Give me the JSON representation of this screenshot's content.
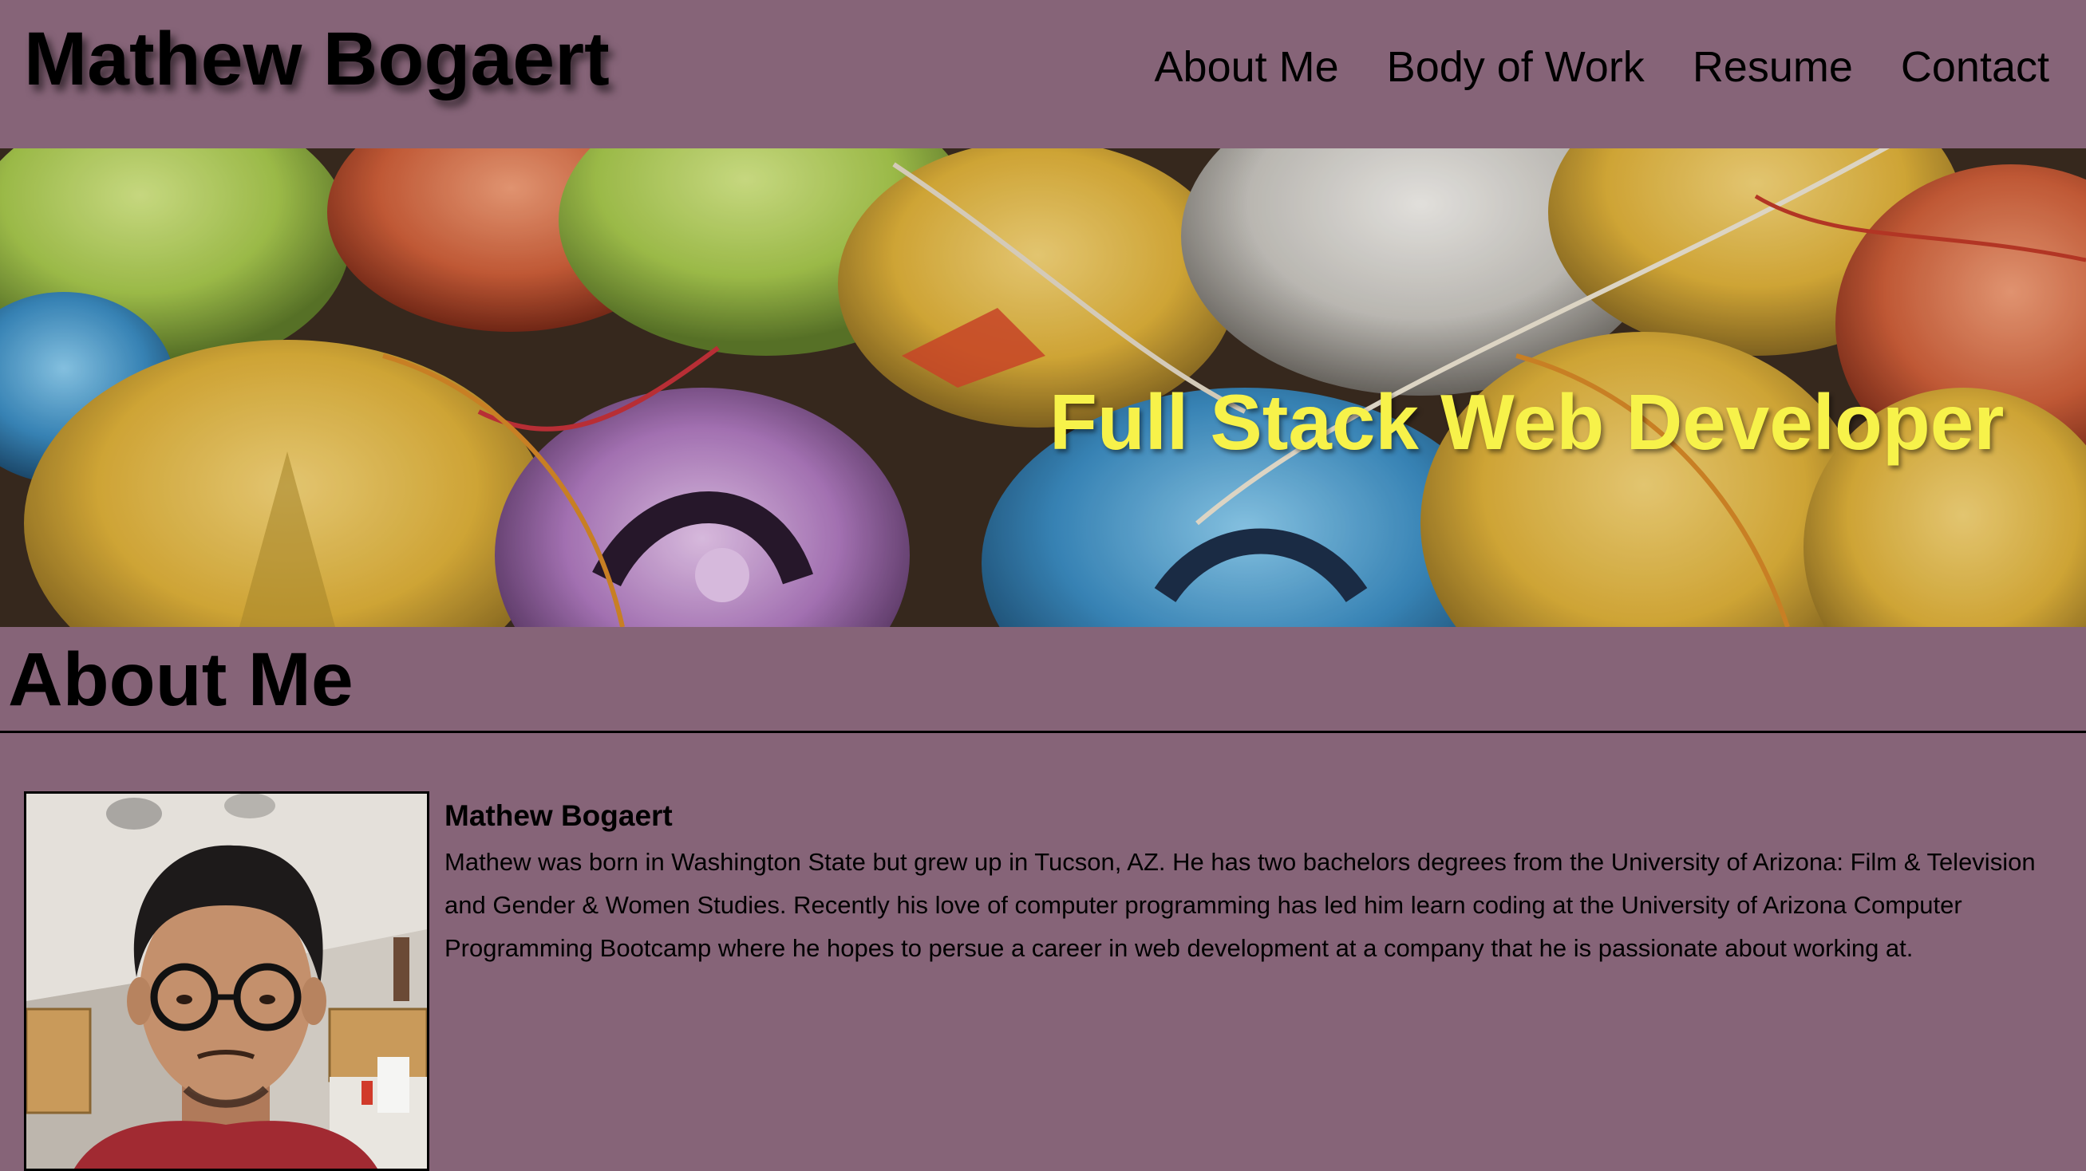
{
  "header": {
    "site_title": "Mathew Bogaert",
    "nav": [
      {
        "label": "About Me"
      },
      {
        "label": "Body of Work"
      },
      {
        "label": "Resume"
      },
      {
        "label": "Contact"
      }
    ]
  },
  "hero": {
    "tagline": "Full Stack Web Developer"
  },
  "about": {
    "section_title": "About Me",
    "name": "Mathew Bogaert",
    "bio": "Mathew was born in Washington State but grew up in Tucson, AZ. He has two bachelors degrees from the University of Arizona: Film & Television and Gender & Women Studies. Recently his love of computer programming has led him learn coding at the University of Arizona Computer Programming Bootcamp where he hopes to persue a career in web development at a company that he is passionate about working at."
  },
  "colors": {
    "page_background": "#866478",
    "tagline": "#f7f24a",
    "text": "#000000"
  }
}
